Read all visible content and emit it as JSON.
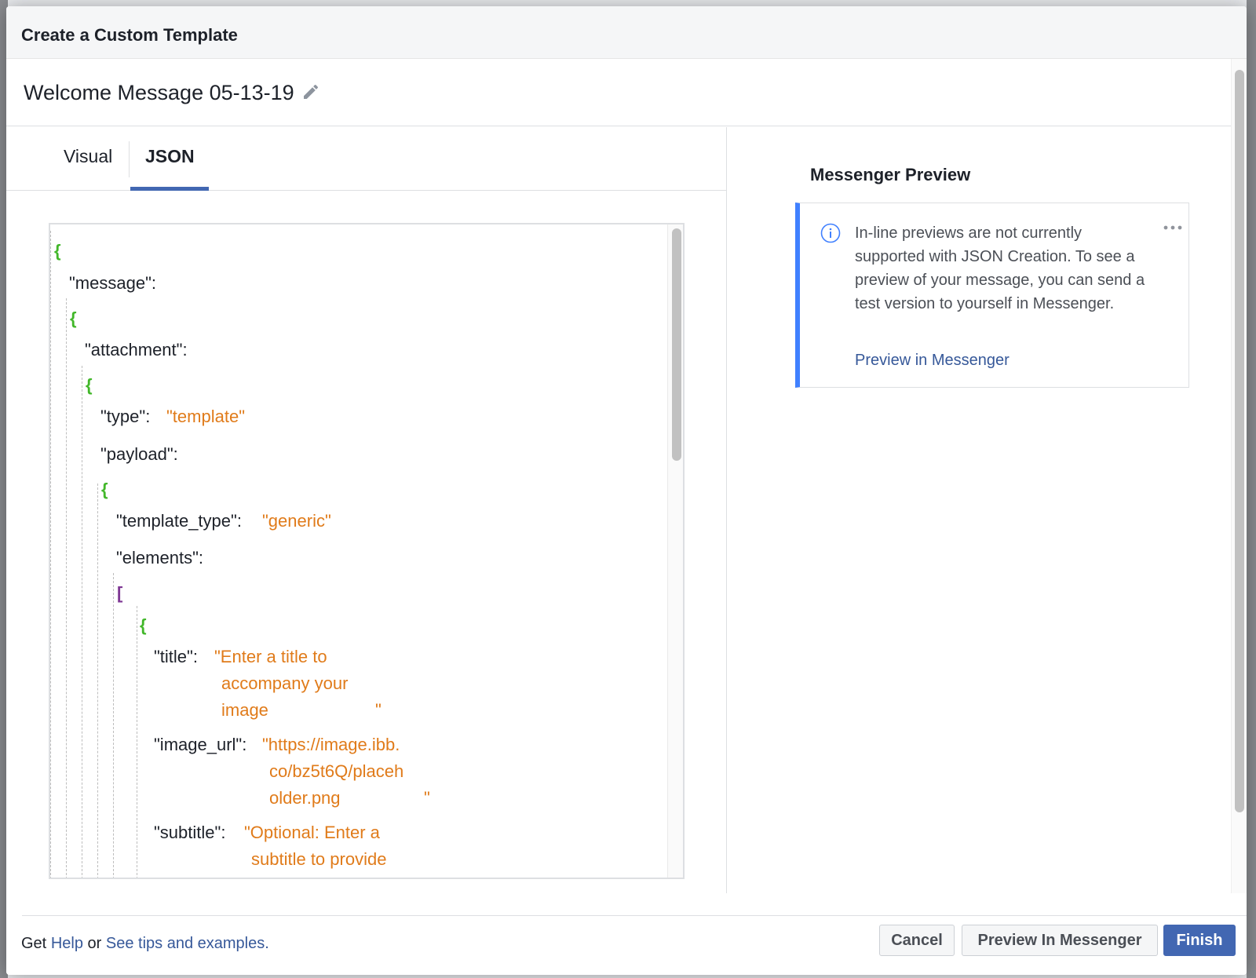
{
  "modal": {
    "title": "Create a Custom Template",
    "template_name": "Welcome Message 05-13-19"
  },
  "tabs": [
    {
      "label": "Visual",
      "active": false
    },
    {
      "label": "JSON",
      "active": true
    }
  ],
  "editor": {
    "lines": {
      "open_root": "{",
      "message_key": "\"message\":",
      "open_message": "{",
      "attachment_key": "\"attachment\":",
      "open_attachment": "{",
      "type_key": "\"type\":",
      "type_value": "\"template\"",
      "payload_key": "\"payload\":",
      "open_payload": "{",
      "template_type_key": "\"template_type\":",
      "template_type_value": "\"generic\"",
      "elements_key": "\"elements\":",
      "open_elements": "[",
      "open_element": "{",
      "title_key": "\"title\":",
      "title_value_1": "\"Enter a title to",
      "title_value_2": "accompany your",
      "title_value_3": "image",
      "title_value_end": "\"",
      "image_url_key": "\"image_url\":",
      "image_url_value_1": "\"https://image.ibb.",
      "image_url_value_2": "co/bz5t6Q/placeh",
      "image_url_value_3": "older.png",
      "image_url_value_end": "\"",
      "subtitle_key": "\"subtitle\":",
      "subtitle_value_1": "\"Optional: Enter a",
      "subtitle_value_2": "subtitle to provide"
    }
  },
  "preview": {
    "title": "Messenger Preview",
    "info_text": "In-line previews are not currently supported with JSON Creation. To see a preview of your message, you can send a test version to yourself in Messenger.",
    "link": "Preview in Messenger"
  },
  "footer": {
    "help_prefix": "Get",
    "help_link": "Help",
    "help_mid": "or",
    "tips_link": "See tips and examples.",
    "cancel_label": "Cancel",
    "preview_label": "Preview In Messenger",
    "finish_label": "Finish"
  },
  "colors": {
    "accent": "#4267b2",
    "brace": "#42b72a",
    "bracket": "#7e3794",
    "string": "#e07b1a",
    "info_border": "#4080ff",
    "link": "#365899"
  },
  "icons": [
    "pencil-icon",
    "info-icon",
    "more-icon"
  ]
}
